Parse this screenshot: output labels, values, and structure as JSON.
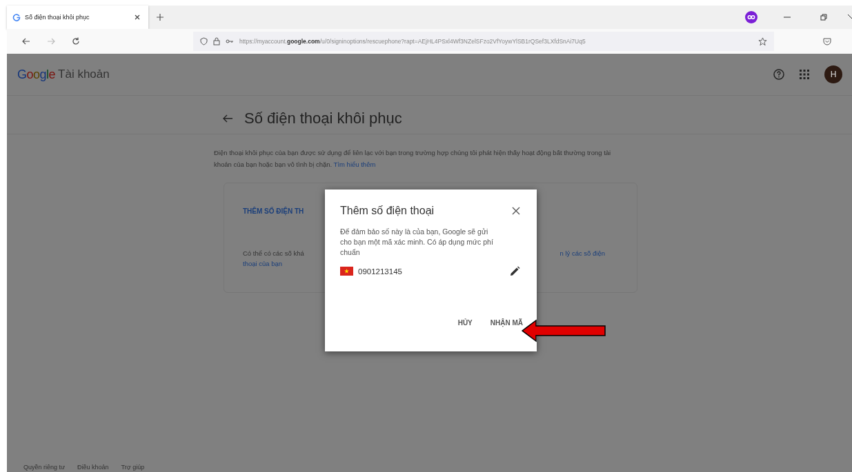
{
  "browser": {
    "tab": {
      "title": "Số điện thoại khôi phục",
      "selected": true
    },
    "url_prefix": "https://myaccount.",
    "url_domain": "google.com",
    "url_rest": "/u/0/signinoptions/rescuephone?rapt=AEjHL4PSxl4Wf3NZelSFzo2VfYoywYlSB1rQSef3LXfdSnAi7Uq5"
  },
  "header": {
    "logo": "Google",
    "product": "Tài khoản",
    "avatar_letter": "H"
  },
  "page": {
    "title": "Số điện thoại khôi phục",
    "description": "Điện thoại khôi phục của bạn được sử dụng để liên lạc với bạn trong trường hợp chúng tôi phát hiện thấy hoạt động bất thường trong tài khoản của bạn hoặc bạn vô tình bị chặn.",
    "learn_more": "Tìm hiểu thêm",
    "card": {
      "add_button": "THÊM SỐ ĐIỆN TH",
      "note_left": "Có thể có các số khá",
      "note_right": "n lý các số điện",
      "note_link": "thoại của bạn"
    }
  },
  "dialog": {
    "title": "Thêm số điện thoại",
    "body": "Để đảm bảo số này là của bạn, Google sẽ gửi cho bạn một mã xác minh. Có áp dụng mức phí chuẩn",
    "phone": "0901213145",
    "buttons": [
      "HỦY",
      "NHẬN MÃ"
    ]
  },
  "footer": [
    "Quyền riêng tư",
    "Điều khoản",
    "Trợ giúp"
  ]
}
